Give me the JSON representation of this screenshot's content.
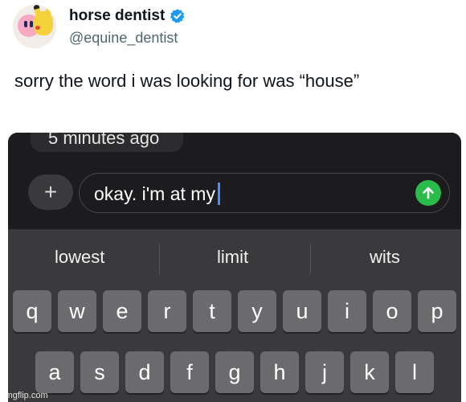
{
  "tweet": {
    "display_name": "horse dentist",
    "handle": "@equine_dentist",
    "text": "sorry the word i was looking for was “house”",
    "verified_color": "#1d9bf0"
  },
  "phone": {
    "timestamp": "5 minutes ago",
    "plus_label": "+",
    "input_value": "okay. i'm at my",
    "send_color": "#2bbb4a",
    "suggestions": [
      "lowest",
      "limit",
      "wits"
    ],
    "keys_row1": [
      "q",
      "w",
      "e",
      "r",
      "t",
      "y",
      "u",
      "i",
      "o",
      "p"
    ],
    "keys_row2": [
      "a",
      "s",
      "d",
      "f",
      "g",
      "h",
      "j",
      "k",
      "l"
    ]
  },
  "watermark": "imgflip.com"
}
